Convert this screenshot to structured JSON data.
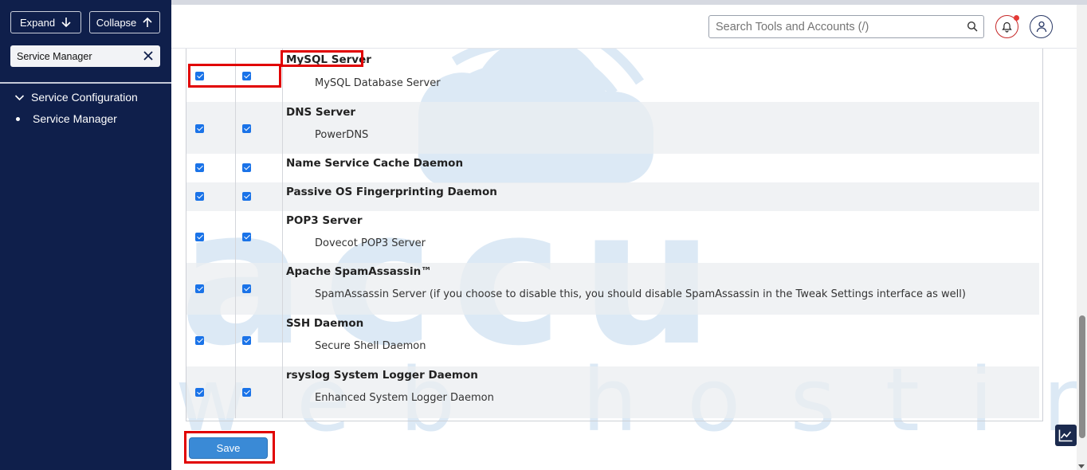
{
  "sidebar": {
    "expand_label": "Expand",
    "collapse_label": "Collapse",
    "search_value": "Service Manager",
    "items": [
      {
        "label": "Service Configuration"
      },
      {
        "label": "Service Manager"
      }
    ]
  },
  "header": {
    "search_placeholder": "Search Tools and Accounts (/)"
  },
  "services": [
    {
      "name": "MySQL Server",
      "description": "MySQL Database Server",
      "enabled": true,
      "monitor": true
    },
    {
      "name": "DNS Server",
      "description": "PowerDNS",
      "enabled": true,
      "monitor": true
    },
    {
      "name": "Name Service Cache Daemon",
      "description": "",
      "enabled": true,
      "monitor": true
    },
    {
      "name": "Passive OS Fingerprinting Daemon",
      "description": "",
      "enabled": true,
      "monitor": true
    },
    {
      "name": "POP3 Server",
      "description": "Dovecot POP3 Server",
      "enabled": true,
      "monitor": true
    },
    {
      "name": "Apache SpamAssassin™",
      "description": "SpamAssassin Server (if you choose to disable this, you should disable SpamAssassin in the Tweak Settings interface as well)",
      "enabled": true,
      "monitor": true
    },
    {
      "name": "SSH Daemon",
      "description": "Secure Shell Daemon",
      "enabled": true,
      "monitor": true
    },
    {
      "name": "rsyslog System Logger Daemon",
      "description": "Enhanced System Logger Daemon",
      "enabled": true,
      "monitor": true
    }
  ],
  "save_label": "Save",
  "watermark": {
    "line1": "accu",
    "line2": "web hosting"
  },
  "colors": {
    "sidebar": "#0f1f4b",
    "accent": "#3a8ad6",
    "highlight": "#e10000",
    "checkbox": "#1a73e8"
  }
}
